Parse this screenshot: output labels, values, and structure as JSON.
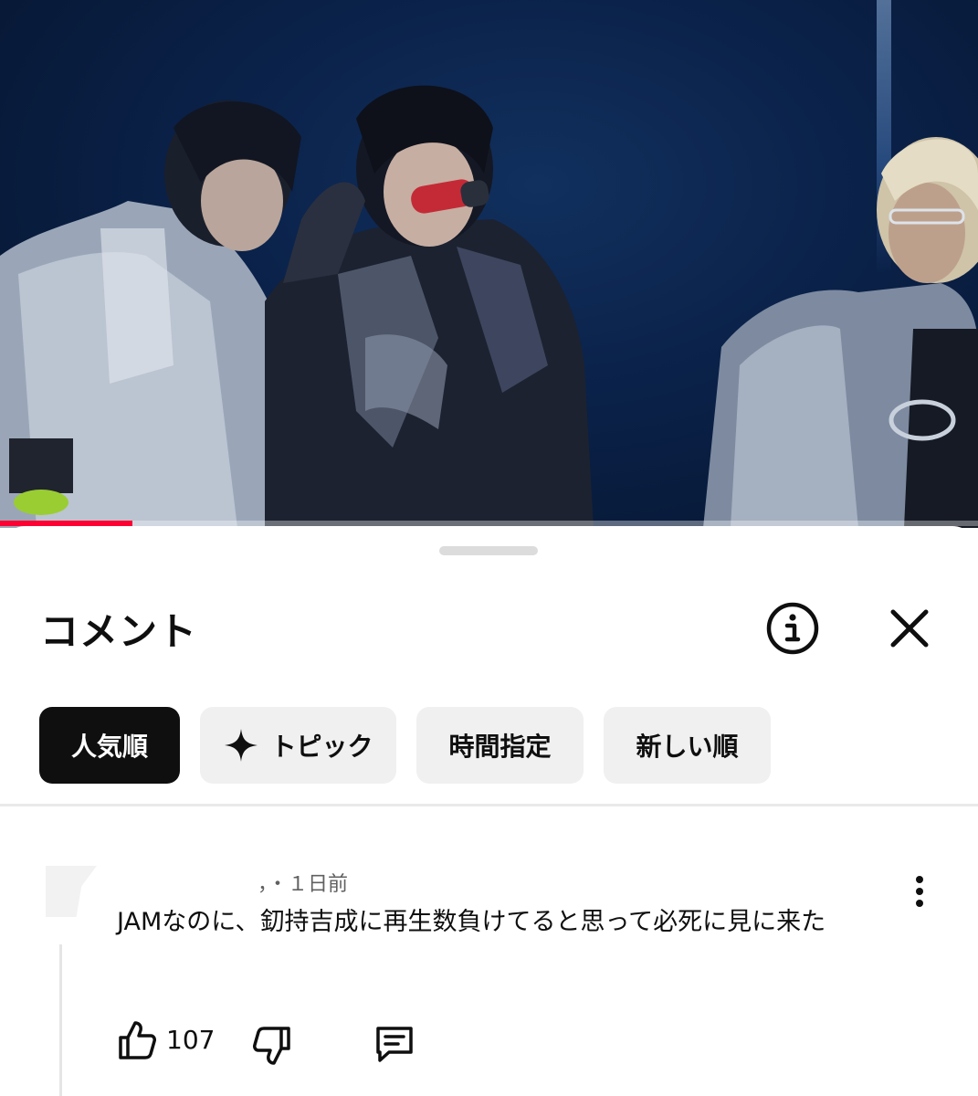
{
  "video": {
    "progress_fraction": 0.135
  },
  "sheet": {
    "title": "コメント"
  },
  "chips": [
    {
      "label": "人気順",
      "active": true
    },
    {
      "label": "トピック",
      "active": false,
      "icon": "sparkle-icon"
    },
    {
      "label": "時間指定",
      "active": false
    },
    {
      "label": "新しい順",
      "active": false
    }
  ],
  "comment": {
    "meta": "，・１日前",
    "text": "JAMなのに、釖持吉成に再生数負けてると思って必死に見に来た",
    "like_count": "107"
  },
  "icons": {
    "info": "info-icon",
    "close": "close-icon",
    "more": "more-vert-icon",
    "like": "thumb-up-icon",
    "dislike": "thumb-down-icon",
    "reply": "reply-icon"
  },
  "colors": {
    "progress": "#ff0033",
    "active_chip": "#0f0f0f",
    "chip_bg": "#f0f0f0"
  }
}
